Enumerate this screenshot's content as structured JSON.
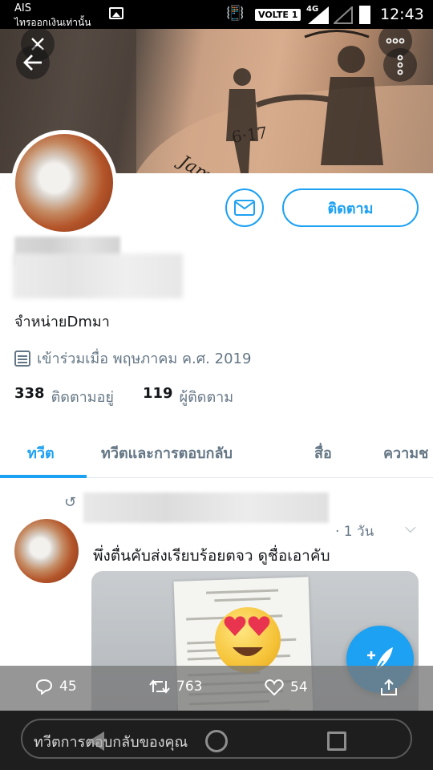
{
  "status_bar": {
    "carrier": "AIS",
    "carrier_sub": "ไทรออกเงินเท่านั้น",
    "network": "VOLTE 1",
    "signal_type": "4G",
    "time": "12:43"
  },
  "header": {
    "close_icon": "close-icon",
    "back_icon": "back-arrow-icon",
    "more_icon": "more-horizontal-icon",
    "overflow_icon": "more-vertical-icon"
  },
  "profile": {
    "bio": "จำหน่ายDmมา",
    "joined": "เข้าร่วมเมื่อ พฤษภาคม ค.ศ. 2019",
    "following_count": "338",
    "following_label": "ติดตามอยู่",
    "followers_count": "119",
    "followers_label": "ผู้ติดตาม",
    "follow_button": "ติดตาม"
  },
  "tabs": [
    {
      "label": "ทวีต",
      "active": true
    },
    {
      "label": "ทวีตและการตอบกลับ",
      "active": false
    },
    {
      "label": "สื่อ",
      "active": false
    },
    {
      "label": "ความช",
      "active": false
    }
  ],
  "tweet": {
    "time": "· 1 วัน",
    "text": "พึ่งตื่นคับส่งเรียบร้อยตจว  ดูชื่อเอาคับ",
    "replies": "45",
    "retweets": "763",
    "likes": "54"
  },
  "compose": {
    "reply_placeholder": "ทวีตการตอบกลับของคุณ"
  },
  "colors": {
    "accent": "#1da1f2",
    "muted": "#657786",
    "text": "#14171a"
  }
}
